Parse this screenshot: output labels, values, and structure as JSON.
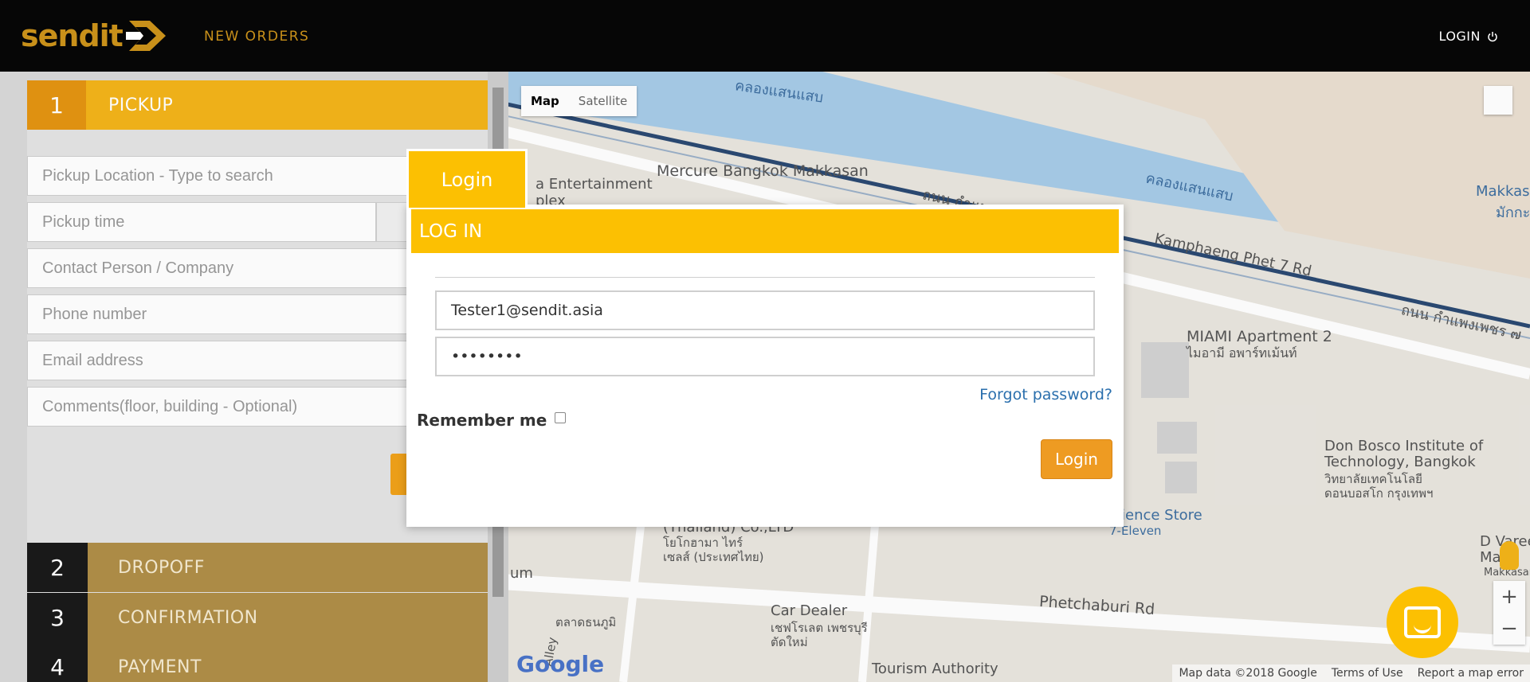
{
  "header": {
    "logo_text": "sendit",
    "nav_new_orders": "NEW ORDERS",
    "nav_login": "LOGIN"
  },
  "steps": {
    "pickup": {
      "number": "1",
      "label": "PICKUP"
    },
    "dropoff": {
      "number": "2",
      "label": "DROPOFF"
    },
    "confirmation": {
      "number": "3",
      "label": "CONFIRMATION"
    },
    "payment": {
      "number": "4",
      "label": "PAYMENT"
    }
  },
  "pickup_form": {
    "location_placeholder": "Pickup Location - Type to search",
    "time_placeholder": "Pickup time",
    "contact_placeholder": "Contact Person / Company",
    "phone_placeholder": "Phone number",
    "email_placeholder": "Email address",
    "comments_placeholder": "Comments(floor, building - Optional)"
  },
  "map": {
    "type_map": "Map",
    "type_satellite": "Satellite",
    "labels": {
      "thai_canal_top": "คลองแสนแสบ",
      "thai_canal_right": "คลองแสนแสบ",
      "mercure": "Mercure Bangkok Makkasan",
      "entertainment": "a Entertainment",
      "entertainment2": "plex",
      "thanon_top": "ถนน กำแพ",
      "kamphaeng": "Kamphaeng Phet 7 Rd",
      "thanon_right": "ถนน กำแพงเพชร ๗",
      "makkas": "Makkas",
      "makkas_th": "มักกะ",
      "miami": "MIAMI Apartment 2",
      "miami_th": "ไมอามี อพาร์ทเม้นท์",
      "don_bosco": "Don Bosco Institute of",
      "don_bosco2": "Technology, Bangkok",
      "don_bosco_th": "วิทยาลัยเทคโนโลยี",
      "don_bosco_th2": "ดอนบอสโก กรุงเทพฯ",
      "convenience": "ience Store",
      "seven_eleven": "7-Eleven",
      "thailand_co": "(Thailand) Co.,LTD",
      "thai_co1": "โยโกฮามา ไทร์",
      "thai_co2": "เซลส์ (ประเทศไทย)",
      "um": "um",
      "car_dealer": "Car Dealer",
      "car_dealer_th1": "เชฟโรเลต เพชรบุรี",
      "car_dealer_th2": "ตัดใหม่",
      "phetchaburi": "Phetchaburi Rd",
      "dhanabhumi": "ตลาดธนภูมิ",
      "alley": "Alley",
      "tourism": "Tourism Authority",
      "dvaree": "D Varee",
      "makkas2": "Mak",
      "makkasan": "Makkasan"
    },
    "footer": {
      "map_data": "Map data ©2018 Google",
      "terms": "Terms of Use",
      "report": "Report a map error"
    },
    "google_logo": "Google"
  },
  "login_modal": {
    "tab_label": "Login",
    "header": "LOG IN",
    "email_value": "Tester1@sendit.asia",
    "password_value": "••••••••",
    "forgot_password": "Forgot password?",
    "remember_me": "Remember me",
    "login_button": "Login"
  }
}
